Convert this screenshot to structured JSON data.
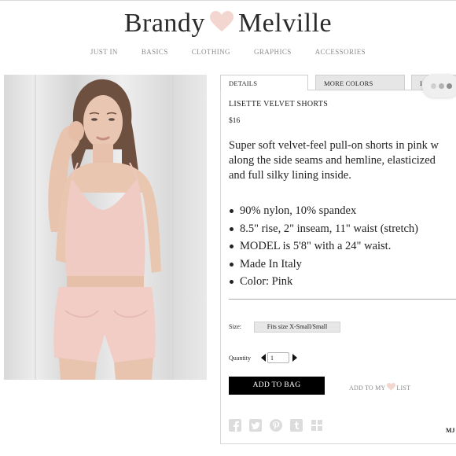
{
  "header": {
    "brand_left": "Brandy",
    "brand_right": "Melville",
    "heart_color": "#f3d6cf",
    "nav": [
      "JUST IN",
      "BASICS",
      "CLOTHING",
      "GRAPHICS",
      "ACCESSORIES"
    ]
  },
  "tabs": {
    "details": "DETAILS",
    "colors": "MORE COLORS",
    "third": "I"
  },
  "product": {
    "name": "LISETTE VELVET SHORTS",
    "price": "$16",
    "description_lines": [
      "Super soft velvet-feel pull-on shorts in pink w",
      "along the side seams and hemline, elasticized",
      "and full silky lining inside."
    ],
    "bullets": [
      "90% nylon, 10% spandex",
      "8.5\" rise, 2\" inseam, 11\" waist (stretch)",
      "MODEL is 5'8\" with a 24\" waist.",
      "Made In Italy",
      "Color: Pink"
    ]
  },
  "purchase": {
    "size_label": "Size:",
    "size_value": "Fits size X-Small/Small",
    "quantity_label": "Quantity",
    "quantity_value": "1",
    "add_to_bag": "ADD TO BAG",
    "wishlist_before": "ADD TO MY",
    "wishlist_after": "LIST"
  },
  "social_icons": [
    "facebook-icon",
    "twitter-icon",
    "pinterest-icon",
    "tumblr-icon",
    "grid-icon"
  ],
  "footer_code": "MJ",
  "colors": {
    "accent_pink": "#f3d6cf",
    "button_bg": "#000000",
    "tab_bg": "#e6e6e6"
  }
}
